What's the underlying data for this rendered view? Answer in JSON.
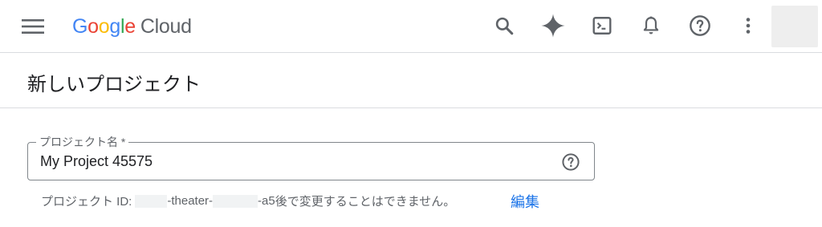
{
  "topbar": {
    "logo": {
      "google": [
        "G",
        "o",
        "o",
        "g",
        "l",
        "e"
      ],
      "google_colors": [
        "#4285F4",
        "#EA4335",
        "#FBBC05",
        "#4285F4",
        "#34A853",
        "#EA4335"
      ],
      "product": "Cloud"
    },
    "icons": [
      "menu-icon",
      "search-icon",
      "gemini-sparkle-icon",
      "cloud-shell-icon",
      "notifications-icon",
      "help-icon",
      "more-vert-icon"
    ]
  },
  "page": {
    "title": "新しいプロジェクト"
  },
  "form": {
    "project_name": {
      "label": "プロジェクト名 *",
      "value": "My Project 45575"
    },
    "project_id": {
      "prefix": "プロジェクト ID:",
      "part1": "-theater-",
      "part2": "-a5",
      "note": " 後で変更することはできません。",
      "edit_label": "編集"
    }
  },
  "colors": {
    "accent": "#1a73e8",
    "icon": "#5f6368",
    "divider": "#dadce0"
  }
}
